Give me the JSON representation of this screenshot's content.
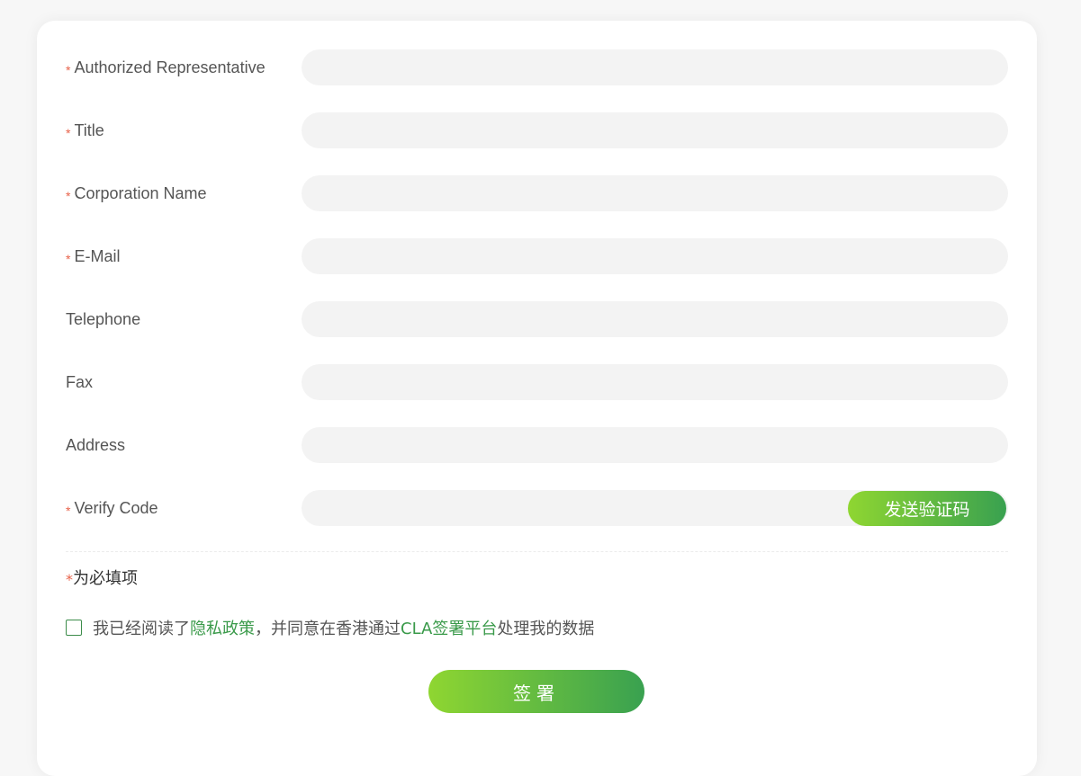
{
  "form": {
    "fields": [
      {
        "label": "Authorized Representative",
        "required": true,
        "value": ""
      },
      {
        "label": "Title",
        "required": true,
        "value": ""
      },
      {
        "label": "Corporation Name",
        "required": true,
        "value": ""
      },
      {
        "label": "E-Mail",
        "required": true,
        "value": ""
      },
      {
        "label": "Telephone",
        "required": false,
        "value": ""
      },
      {
        "label": "Fax",
        "required": false,
        "value": ""
      },
      {
        "label": "Address",
        "required": false,
        "value": ""
      },
      {
        "label": "Verify Code",
        "required": true,
        "value": ""
      }
    ],
    "required_star": "*",
    "send_code_label": "发送验证码",
    "required_note": "为必填项",
    "agreement": {
      "prefix": "我已经阅读了",
      "privacy_link": "隐私政策",
      "middle": "，并同意在香港通过",
      "platform_link": "CLA签署平台",
      "suffix": "处理我的数据",
      "checked": false
    },
    "submit_label": "签署"
  },
  "colors": {
    "accent_start": "#8fd631",
    "accent_end": "#39a150",
    "link": "#3a9a4a",
    "required": "#e8624a",
    "input_bg": "#f3f3f3"
  }
}
